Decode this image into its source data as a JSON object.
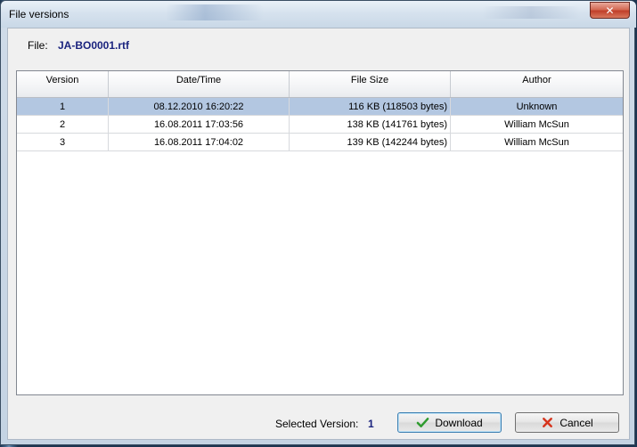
{
  "window": {
    "title": "File versions",
    "close_glyph": "✕"
  },
  "file": {
    "label": "File:",
    "name": "JA-BO0001.rtf"
  },
  "table": {
    "columns": [
      "Version",
      "Date/Time",
      "File Size",
      "Author"
    ],
    "rows": [
      {
        "version": "1",
        "datetime": "08.12.2010 16:20:22",
        "size": "116 KB (118503 bytes)",
        "author": "Unknown",
        "selected": true
      },
      {
        "version": "2",
        "datetime": "16.08.2011 17:03:56",
        "size": "138 KB (141761 bytes)",
        "author": "William McSun",
        "selected": false
      },
      {
        "version": "3",
        "datetime": "16.08.2011 17:04:02",
        "size": "139 KB (142244 bytes)",
        "author": "William McSun",
        "selected": false
      }
    ]
  },
  "footer": {
    "selected_label": "Selected Version:",
    "selected_value": "1",
    "download_label": "Download",
    "download_icon": "check-icon",
    "cancel_label": "Cancel",
    "cancel_icon": "x-icon"
  },
  "colors": {
    "selection": "#b3c7e1",
    "accent_text": "#1a237e",
    "check": "#2e9b2e",
    "cancel_x": "#d6341c"
  }
}
